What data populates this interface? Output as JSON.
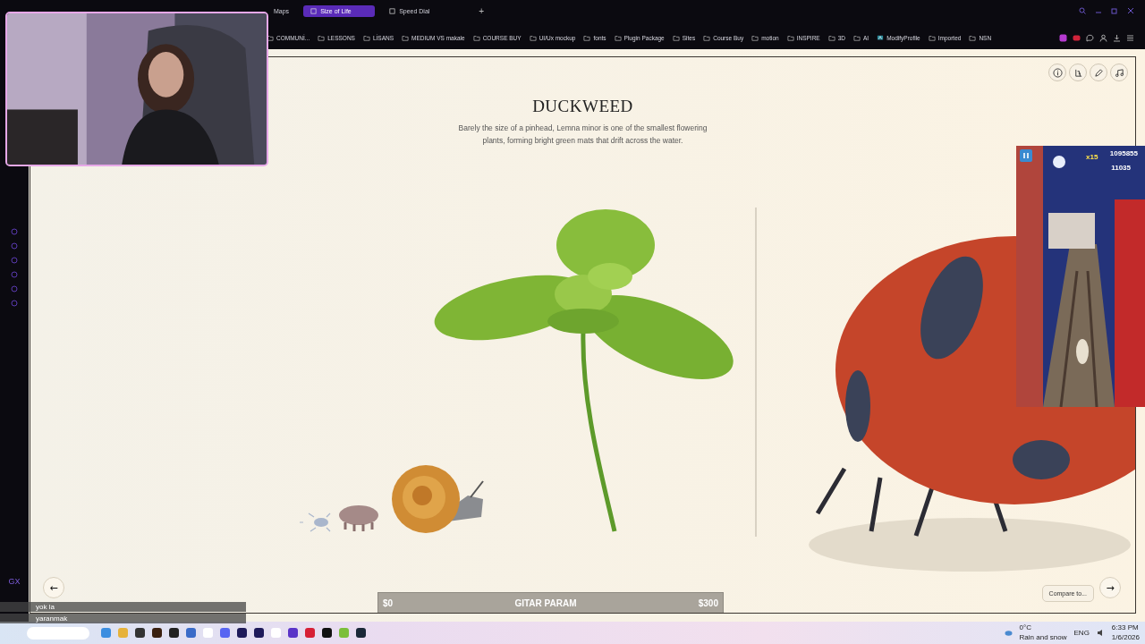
{
  "browser": {
    "tabs": [
      {
        "label": "Maps",
        "selected": false
      },
      {
        "label": "Size of Life",
        "selected": true
      },
      {
        "label": "Speed Dial",
        "selected": false
      }
    ],
    "new_tab": "+",
    "bookmarks": [
      {
        "label": "COMMUNİ...",
        "kind": "folder"
      },
      {
        "label": "LESSONS",
        "kind": "folder"
      },
      {
        "label": "LİSANS",
        "kind": "folder"
      },
      {
        "label": "MEDIUM VS makale",
        "kind": "folder"
      },
      {
        "label": "COURSE BUY",
        "kind": "folder"
      },
      {
        "label": "UI/Ux mockup",
        "kind": "folder"
      },
      {
        "label": "fonts",
        "kind": "folder"
      },
      {
        "label": "Plugin Package",
        "kind": "folder"
      },
      {
        "label": "Sites",
        "kind": "folder"
      },
      {
        "label": "Course Buy",
        "kind": "folder"
      },
      {
        "label": "motion",
        "kind": "folder"
      },
      {
        "label": "INSPIRE",
        "kind": "folder"
      },
      {
        "label": "3D",
        "kind": "folder"
      },
      {
        "label": "AI",
        "kind": "folder"
      },
      {
        "label": "ModifyProfile",
        "kind": "link"
      },
      {
        "label": "Imported",
        "kind": "folder"
      },
      {
        "label": "NSN",
        "kind": "folder"
      }
    ],
    "sidebar_logo": "GX"
  },
  "page": {
    "title": "DUCKWEED",
    "description": "Barely the size of a pinhead, Lemna minor is one of the smallest flowering plants, forming bright green mats that drift across the water.",
    "prev": "←",
    "next": "→",
    "compare_button": "Compare to...",
    "slider": {
      "min": "$0",
      "label": "GITAR PARAM",
      "max": "$300"
    }
  },
  "overlays": {
    "game": {
      "multiplier": "x15",
      "score": "1095855",
      "coins": "11035"
    },
    "chat": [
      {
        "message": "yok la"
      },
      {
        "message": "yaranmak"
      }
    ]
  },
  "taskbar": {
    "weather": {
      "temp": "0°C",
      "condition": "Rain and snow"
    },
    "language": "ENG",
    "time": "6:33 PM",
    "date": "1/6/2026"
  }
}
